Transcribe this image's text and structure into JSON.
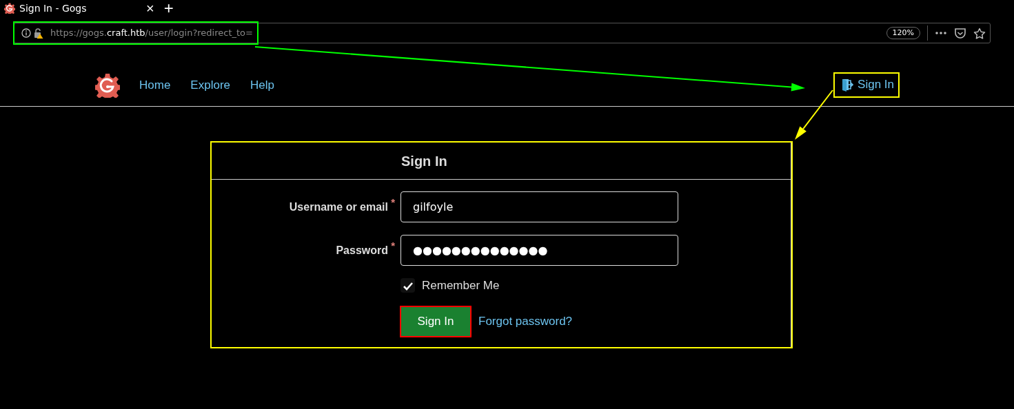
{
  "browser_tab": {
    "title": "Sign In - Gogs",
    "close": "×",
    "new_tab": "+"
  },
  "address_bar": {
    "url_prefix": "https://gogs.",
    "url_host": "craft.htb",
    "url_path": "/user/login?redirect_to=",
    "zoom": "120%"
  },
  "nav": {
    "items": [
      {
        "label": "Home"
      },
      {
        "label": "Explore"
      },
      {
        "label": "Help"
      }
    ],
    "sign_in": {
      "label": "Sign In"
    }
  },
  "form": {
    "title": "Sign In",
    "fields": [
      {
        "label": "Username or email",
        "required_mark": "*",
        "value": "gilfoyle"
      },
      {
        "label": "Password",
        "required_mark": "*",
        "value": "●●●●●●●●●●●●●●"
      }
    ],
    "remember": {
      "label": "Remember Me",
      "checked": true
    },
    "submit": {
      "label": "Sign In"
    },
    "forgot": "Forgot password?"
  },
  "annotations": [
    {
      "kind": "frame",
      "color": "#00ff00"
    },
    {
      "kind": "frame",
      "color": "#ffff00"
    },
    {
      "kind": "frame",
      "color": "#ffff00"
    },
    {
      "kind": "frame",
      "color": "#ff0000"
    },
    {
      "kind": "arrow",
      "color": "#00ff00"
    },
    {
      "kind": "arrow",
      "color": "#ffff00"
    }
  ]
}
